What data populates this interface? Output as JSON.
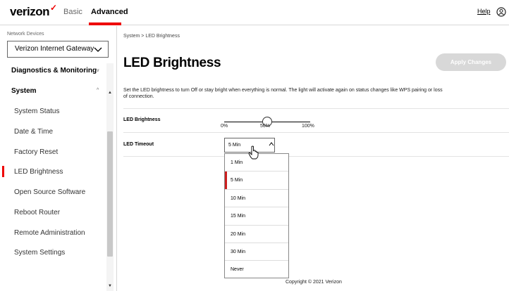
{
  "header": {
    "logo": "verizon",
    "tabs": [
      "Basic",
      "Advanced"
    ],
    "active_tab": "Advanced",
    "help": "Help",
    "accent": "#ee0000"
  },
  "sidebar": {
    "network_devices_label": "Network Devices",
    "gateway": "Verizon Internet Gateway",
    "sections": [
      {
        "label": "Diagnostics & Monitoring",
        "expanded": false
      },
      {
        "label": "System",
        "expanded": true
      }
    ],
    "items": [
      {
        "label": "System Status"
      },
      {
        "label": "Date & Time"
      },
      {
        "label": "Factory Reset"
      },
      {
        "label": "LED Brightness",
        "active": true
      },
      {
        "label": "Open Source Software"
      },
      {
        "label": "Reboot Router"
      },
      {
        "label": "Remote Administration"
      },
      {
        "label": "System Settings"
      }
    ]
  },
  "main": {
    "breadcrumb": "System  >  LED Brightness",
    "title": "LED Brightness",
    "apply_button": "Apply Changes",
    "description": "Set the LED brightness to turn Off or stay bright when everything is normal. The light will activate again on status changes like WPS pairing or loss of connection.",
    "brightness": {
      "label": "LED Brightness",
      "ticks": [
        "0%",
        "50%",
        "100%"
      ],
      "value_percent": 50
    },
    "timeout": {
      "label": "LED Timeout",
      "selected": "5 Min",
      "options": [
        "1 Min",
        "5 Min",
        "10 Min",
        "15 Min",
        "20 Min",
        "30 Min",
        "Never"
      ]
    },
    "copyright": "Copyright © 2021 Verizon"
  }
}
